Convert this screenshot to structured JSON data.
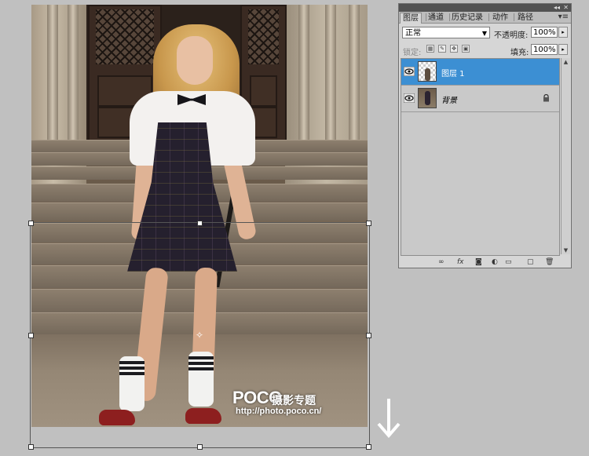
{
  "panel": {
    "tabs": [
      {
        "label": "图层",
        "active": true
      },
      {
        "label": "通道",
        "active": false
      },
      {
        "label": "历史记录",
        "active": false
      },
      {
        "label": "动作",
        "active": false
      },
      {
        "label": "路径",
        "active": false
      }
    ],
    "menu_icon": "panel-menu-icon",
    "blend_mode": "正常",
    "opacity_label": "不透明度:",
    "opacity_value": "100%",
    "lock_label": "锁定:",
    "fill_label": "填充:",
    "fill_value": "100%",
    "layers": [
      {
        "name": "图层 1",
        "selected": true,
        "visible": true,
        "thumb": "transparent-photo",
        "locked": false
      },
      {
        "name": "背景",
        "selected": false,
        "visible": true,
        "thumb": "photo",
        "locked": true
      }
    ],
    "accent_color": "#3c8fd3"
  },
  "canvas": {
    "watermark_logo": "POCO",
    "watermark_title": "摄影专题",
    "watermark_url": "http://photo.poco.cn/"
  }
}
